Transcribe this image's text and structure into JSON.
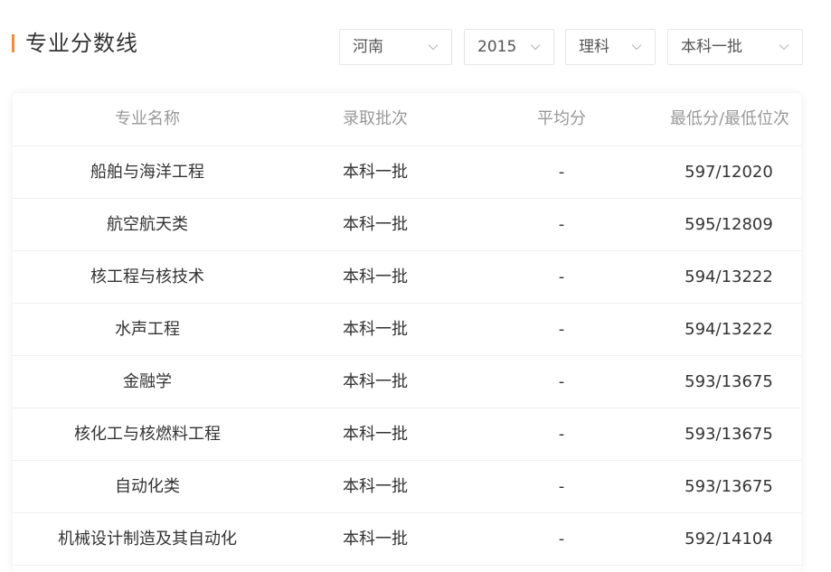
{
  "header": {
    "title": "专业分数线"
  },
  "filters": {
    "province": "河南",
    "year": "2015",
    "subject": "理科",
    "batch": "本科一批"
  },
  "table": {
    "columns": [
      "专业名称",
      "录取批次",
      "平均分",
      "最低分/最低位次"
    ],
    "rows": [
      {
        "major": "船舶与海洋工程",
        "batch": "本科一批",
        "avg": "-",
        "min": "597/12020"
      },
      {
        "major": "航空航天类",
        "batch": "本科一批",
        "avg": "-",
        "min": "595/12809"
      },
      {
        "major": "核工程与核技术",
        "batch": "本科一批",
        "avg": "-",
        "min": "594/13222"
      },
      {
        "major": "水声工程",
        "batch": "本科一批",
        "avg": "-",
        "min": "594/13222"
      },
      {
        "major": "金融学",
        "batch": "本科一批",
        "avg": "-",
        "min": "593/13675"
      },
      {
        "major": "核化工与核燃料工程",
        "batch": "本科一批",
        "avg": "-",
        "min": "593/13675"
      },
      {
        "major": "自动化类",
        "batch": "本科一批",
        "avg": "-",
        "min": "593/13675"
      },
      {
        "major": "机械设计制造及其自动化",
        "batch": "本科一批",
        "avg": "-",
        "min": "592/14104"
      }
    ]
  },
  "colors": {
    "accent": "#f08c3a",
    "header_text": "#999999",
    "body_text": "#333333",
    "border": "#e6e6e6"
  },
  "icons": {
    "dropdown": "chevron-down-icon"
  }
}
